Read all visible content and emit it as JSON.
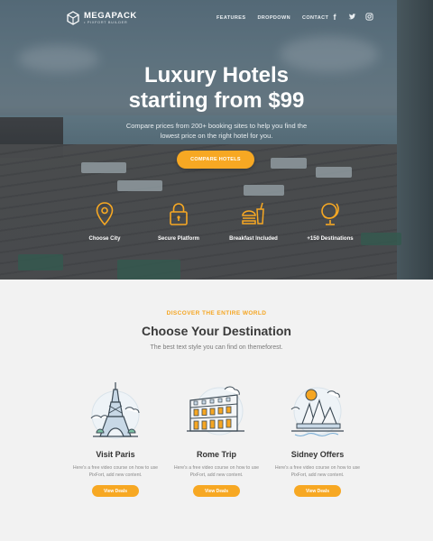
{
  "brand": {
    "name": "MEGAPACK",
    "tagline": "• PIXFORT BUILDER"
  },
  "nav": {
    "items": [
      "FEATURES",
      "DROPDOWN",
      "CONTACT"
    ]
  },
  "social": {
    "facebook": "f",
    "twitter": "t",
    "instagram": "▢"
  },
  "hero": {
    "title_line1": "Luxury Hotels",
    "title_line2": "starting from $99",
    "subtitle": "Compare prices from 200+ booking sites to help you find the lowest price on the right hotel for you.",
    "cta": "COMPARE HOTELS"
  },
  "features": [
    {
      "label": "Choose City",
      "icon": "map-pin-icon"
    },
    {
      "label": "Secure Platform",
      "icon": "lock-icon"
    },
    {
      "label": "Breakfast Included",
      "icon": "burger-drink-icon"
    },
    {
      "label": "+150 Destinations",
      "icon": "globe-icon"
    }
  ],
  "destinations": {
    "kicker": "DISCOVER THE ENTIRE WORLD",
    "title": "Choose Your Destination",
    "subtitle": "The best text style you can find on themeforest.",
    "cards": [
      {
        "title": "Visit Paris",
        "desc": "Here's a free video course on how to use PixFort, add new content.",
        "button": "View Deals",
        "icon": "eiffel-tower-illustration"
      },
      {
        "title": "Rome Trip",
        "desc": "Here's a free video course on how to use PixFort, add new content.",
        "button": "View Deals",
        "icon": "colosseum-illustration"
      },
      {
        "title": "Sidney Offers",
        "desc": "Here's a free video course on how to use PixFort, add new content.",
        "button": "View Deals",
        "icon": "opera-house-illustration"
      }
    ]
  },
  "colors": {
    "accent": "#f7a823",
    "kicker": "#f5a623",
    "heading": "#3a3a3a",
    "section_bg": "#f2f2f2"
  }
}
